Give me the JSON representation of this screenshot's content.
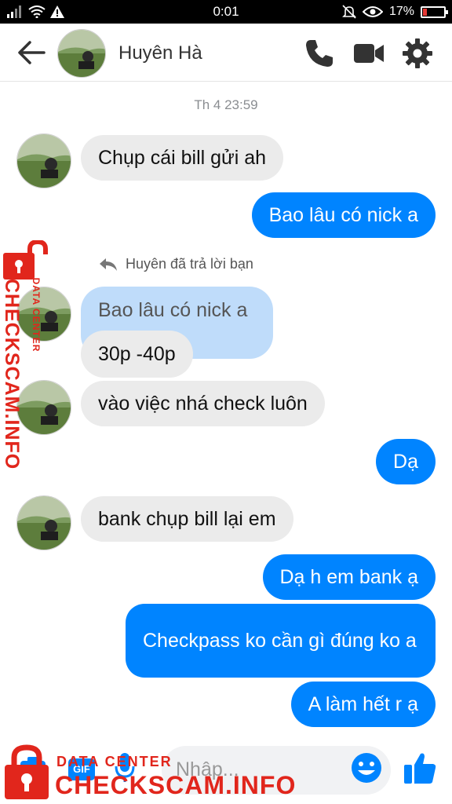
{
  "status_bar": {
    "time": "0:01",
    "battery": "17%",
    "battery_level": 0.17
  },
  "header": {
    "contact_name": "Huyên Hà"
  },
  "timestamp": "Th 4 23:59",
  "messages": [
    {
      "dir": "in",
      "text": "Chụp cái bill gửi ah"
    },
    {
      "dir": "out",
      "text": "Bao lâu có nick a"
    },
    {
      "reply_note": "Huyên đã trả lời bạn",
      "quoted": "Bao lâu có nick a",
      "dir": "in",
      "text": "30p -40p"
    },
    {
      "dir": "in",
      "text": "vào việc nhá check luôn"
    },
    {
      "dir": "out",
      "text": "Dạ"
    },
    {
      "dir": "in",
      "text": "bank chụp bill lại em"
    },
    {
      "dir": "out",
      "text": "Dạ h em bank ạ"
    },
    {
      "dir": "out",
      "text": "Checkpass ko cần gì đúng ko a"
    },
    {
      "dir": "out",
      "text": "A làm hết r ạ"
    }
  ],
  "composer": {
    "placeholder": "Nhập...",
    "gif_label": "GIF"
  },
  "watermark": {
    "top_line": "DATA CENTER",
    "brand": "CHECKSCAM.INFO"
  },
  "colors": {
    "messenger_blue": "#0084ff",
    "bubble_gray": "#ebebeb",
    "quoted_blue": "#bfdcfa",
    "watermark_red": "#e1261c"
  }
}
